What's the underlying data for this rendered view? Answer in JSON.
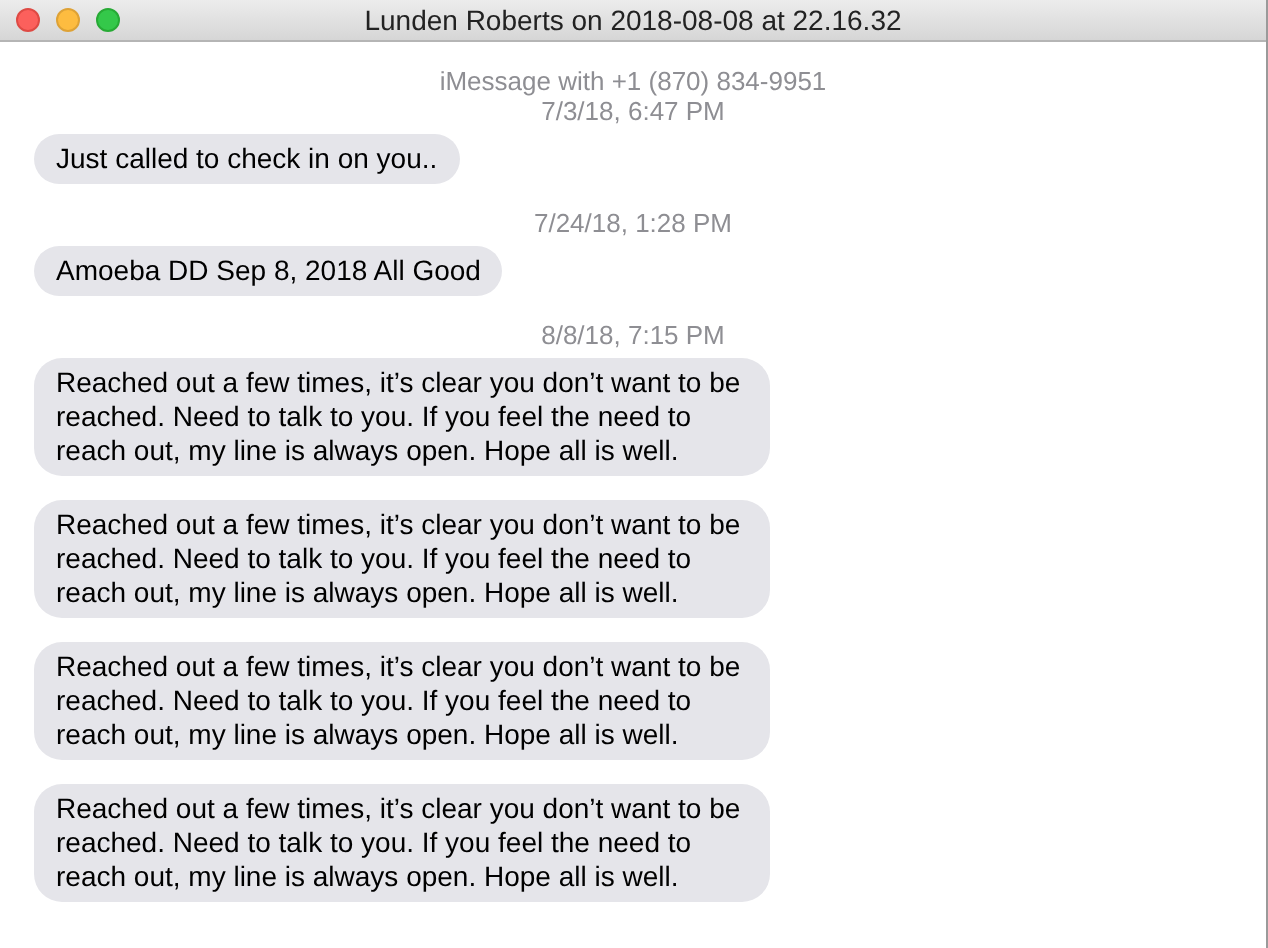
{
  "window": {
    "title": "Lunden Roberts on 2018-08-08 at 22.16.32"
  },
  "conversation": [
    {
      "kind": "header",
      "text": "iMessage with +1 (870) 834-9951"
    },
    {
      "kind": "timestamp",
      "text": "7/3/18, 6:47 PM"
    },
    {
      "kind": "message",
      "text": "Just called to check in on you.."
    },
    {
      "kind": "timestamp",
      "text": "7/24/18, 1:28 PM"
    },
    {
      "kind": "message",
      "text": "Amoeba DD Sep 8, 2018 All Good"
    },
    {
      "kind": "timestamp",
      "text": "8/8/18, 7:15 PM"
    },
    {
      "kind": "message",
      "text": "Reached out a few times, it’s clear you don’t want to be reached. Need to talk to you. If you feel the need to reach out, my line is always open. Hope all is well."
    },
    {
      "kind": "message",
      "text": "Reached out a few times, it’s clear you don’t want to be reached. Need to talk to you. If you feel the need to reach out, my line is always open. Hope all is well."
    },
    {
      "kind": "message",
      "text": "Reached out a few times, it’s clear you don’t want to be reached. Need to talk to you. If you feel the need to reach out, my line is always open. Hope all is well."
    },
    {
      "kind": "message",
      "text": "Reached out a few times, it’s clear you don’t want to be reached. Need to talk to you. If you feel the need to reach out, my line is always open. Hope all is well."
    }
  ]
}
